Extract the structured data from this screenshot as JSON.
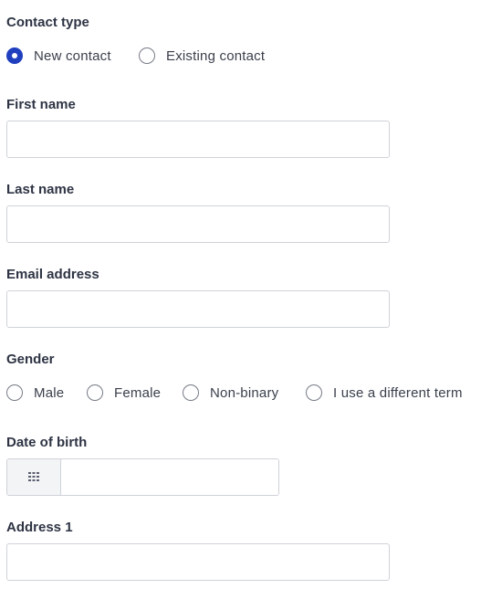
{
  "contact_type": {
    "label": "Contact type",
    "options": [
      {
        "label": "New contact",
        "checked": true
      },
      {
        "label": "Existing contact",
        "checked": false
      }
    ]
  },
  "first_name": {
    "label": "First name",
    "value": ""
  },
  "last_name": {
    "label": "Last name",
    "value": ""
  },
  "email": {
    "label": "Email address",
    "value": ""
  },
  "gender": {
    "label": "Gender",
    "options": [
      {
        "label": "Male",
        "checked": false
      },
      {
        "label": "Female",
        "checked": false
      },
      {
        "label": "Non-binary",
        "checked": false
      },
      {
        "label": "I use a different term",
        "checked": false
      }
    ]
  },
  "date_of_birth": {
    "label": "Date of birth",
    "value": "",
    "icon": "calendar-grid-icon"
  },
  "address1": {
    "label": "Address 1",
    "value": ""
  },
  "colors": {
    "accent": "#1f3fbf",
    "border": "#cfd2d8",
    "label": "#2e3444"
  }
}
